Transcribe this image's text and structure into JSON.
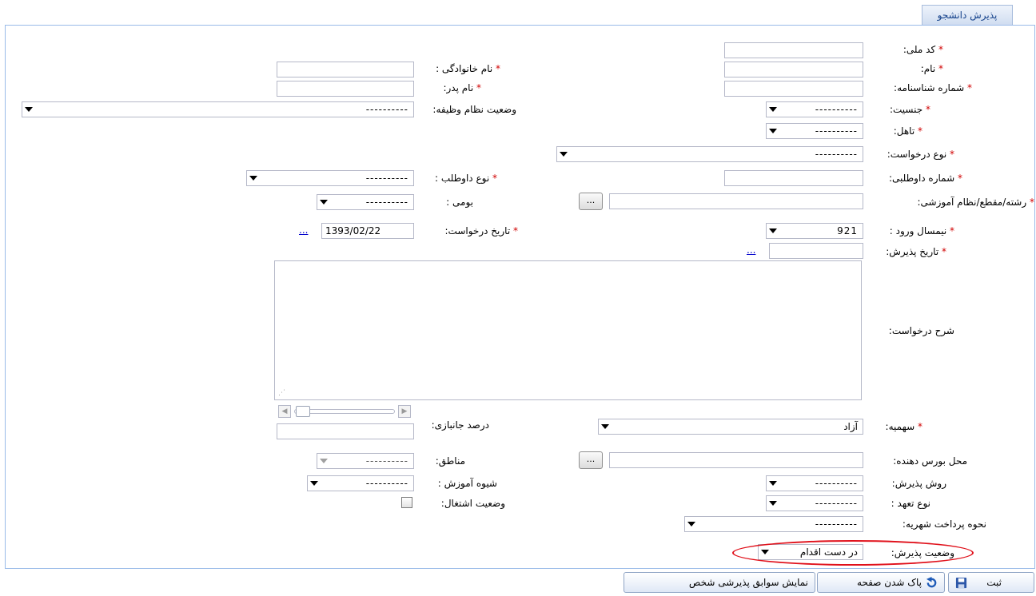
{
  "tab": {
    "title": "پذیرش دانشجو"
  },
  "fields": {
    "national_code": {
      "label": "کد ملی:",
      "value": ""
    },
    "first_name": {
      "label": "نام:",
      "value": ""
    },
    "last_name": {
      "label": "نام خانوادگی :",
      "value": ""
    },
    "id_number": {
      "label": "شماره شناسنامه:",
      "value": ""
    },
    "father_name": {
      "label": "نام پدر:",
      "value": ""
    },
    "gender": {
      "label": "جنسیت:",
      "value": "----------"
    },
    "military_status": {
      "label": "وضعیت نظام وظیفه:",
      "value": "----------"
    },
    "marital_status": {
      "label": "تاهل:",
      "value": "----------"
    },
    "request_type": {
      "label": "نوع درخواست:",
      "value": "----------"
    },
    "applicant_number": {
      "label": "شماره داوطلبی:",
      "value": ""
    },
    "applicant_type": {
      "label": "نوع داوطلب :",
      "value": "----------"
    },
    "field_of_study": {
      "label": "رشته/مقطع/نظام آموزشی:",
      "value": "",
      "button": "..."
    },
    "native": {
      "label": "بومی :",
      "value": "----------"
    },
    "entry_semester": {
      "label": "نیمسال ورود :",
      "value": "921"
    },
    "request_date": {
      "label": "تاریخ درخواست:",
      "value": "1393/02/22",
      "link": "..."
    },
    "admission_date": {
      "label": "تاریخ پذیرش:",
      "value": "",
      "link": "..."
    },
    "request_description": {
      "label": "شرح درخواست:",
      "value": ""
    },
    "quota": {
      "label": "سهمیه:",
      "value": "آزاد"
    },
    "veteran_percent": {
      "label": "درصد جانبازی:",
      "value": ""
    },
    "scholarship_place": {
      "label": "محل بورس دهنده:",
      "value": "",
      "button": "..."
    },
    "regions": {
      "label": "مناطق:",
      "value": "----------"
    },
    "admission_method": {
      "label": "روش پذیرش:",
      "value": "----------"
    },
    "education_mode": {
      "label": "شیوه آموزش :",
      "value": "----------"
    },
    "commitment_type": {
      "label": "نوع تعهد :",
      "value": "----------"
    },
    "employment_status": {
      "label": "وضعیت اشتغال:",
      "checked": false
    },
    "tuition_payment": {
      "label": "نحوه پرداخت شهریه:",
      "value": "----------"
    },
    "admission_status": {
      "label": "وضعیت پذیرش:",
      "value": "در دست اقدام"
    }
  },
  "required_mark": "*",
  "buttons": {
    "save": "ثبت",
    "clear": "پاک شدن صفحه",
    "history": "نمایش سوابق پذیرشی شخص"
  },
  "colors": {
    "accent": "#15428b",
    "border": "#99bbe8",
    "highlight_ellipse": "#e0101a",
    "required": "#d00000"
  }
}
